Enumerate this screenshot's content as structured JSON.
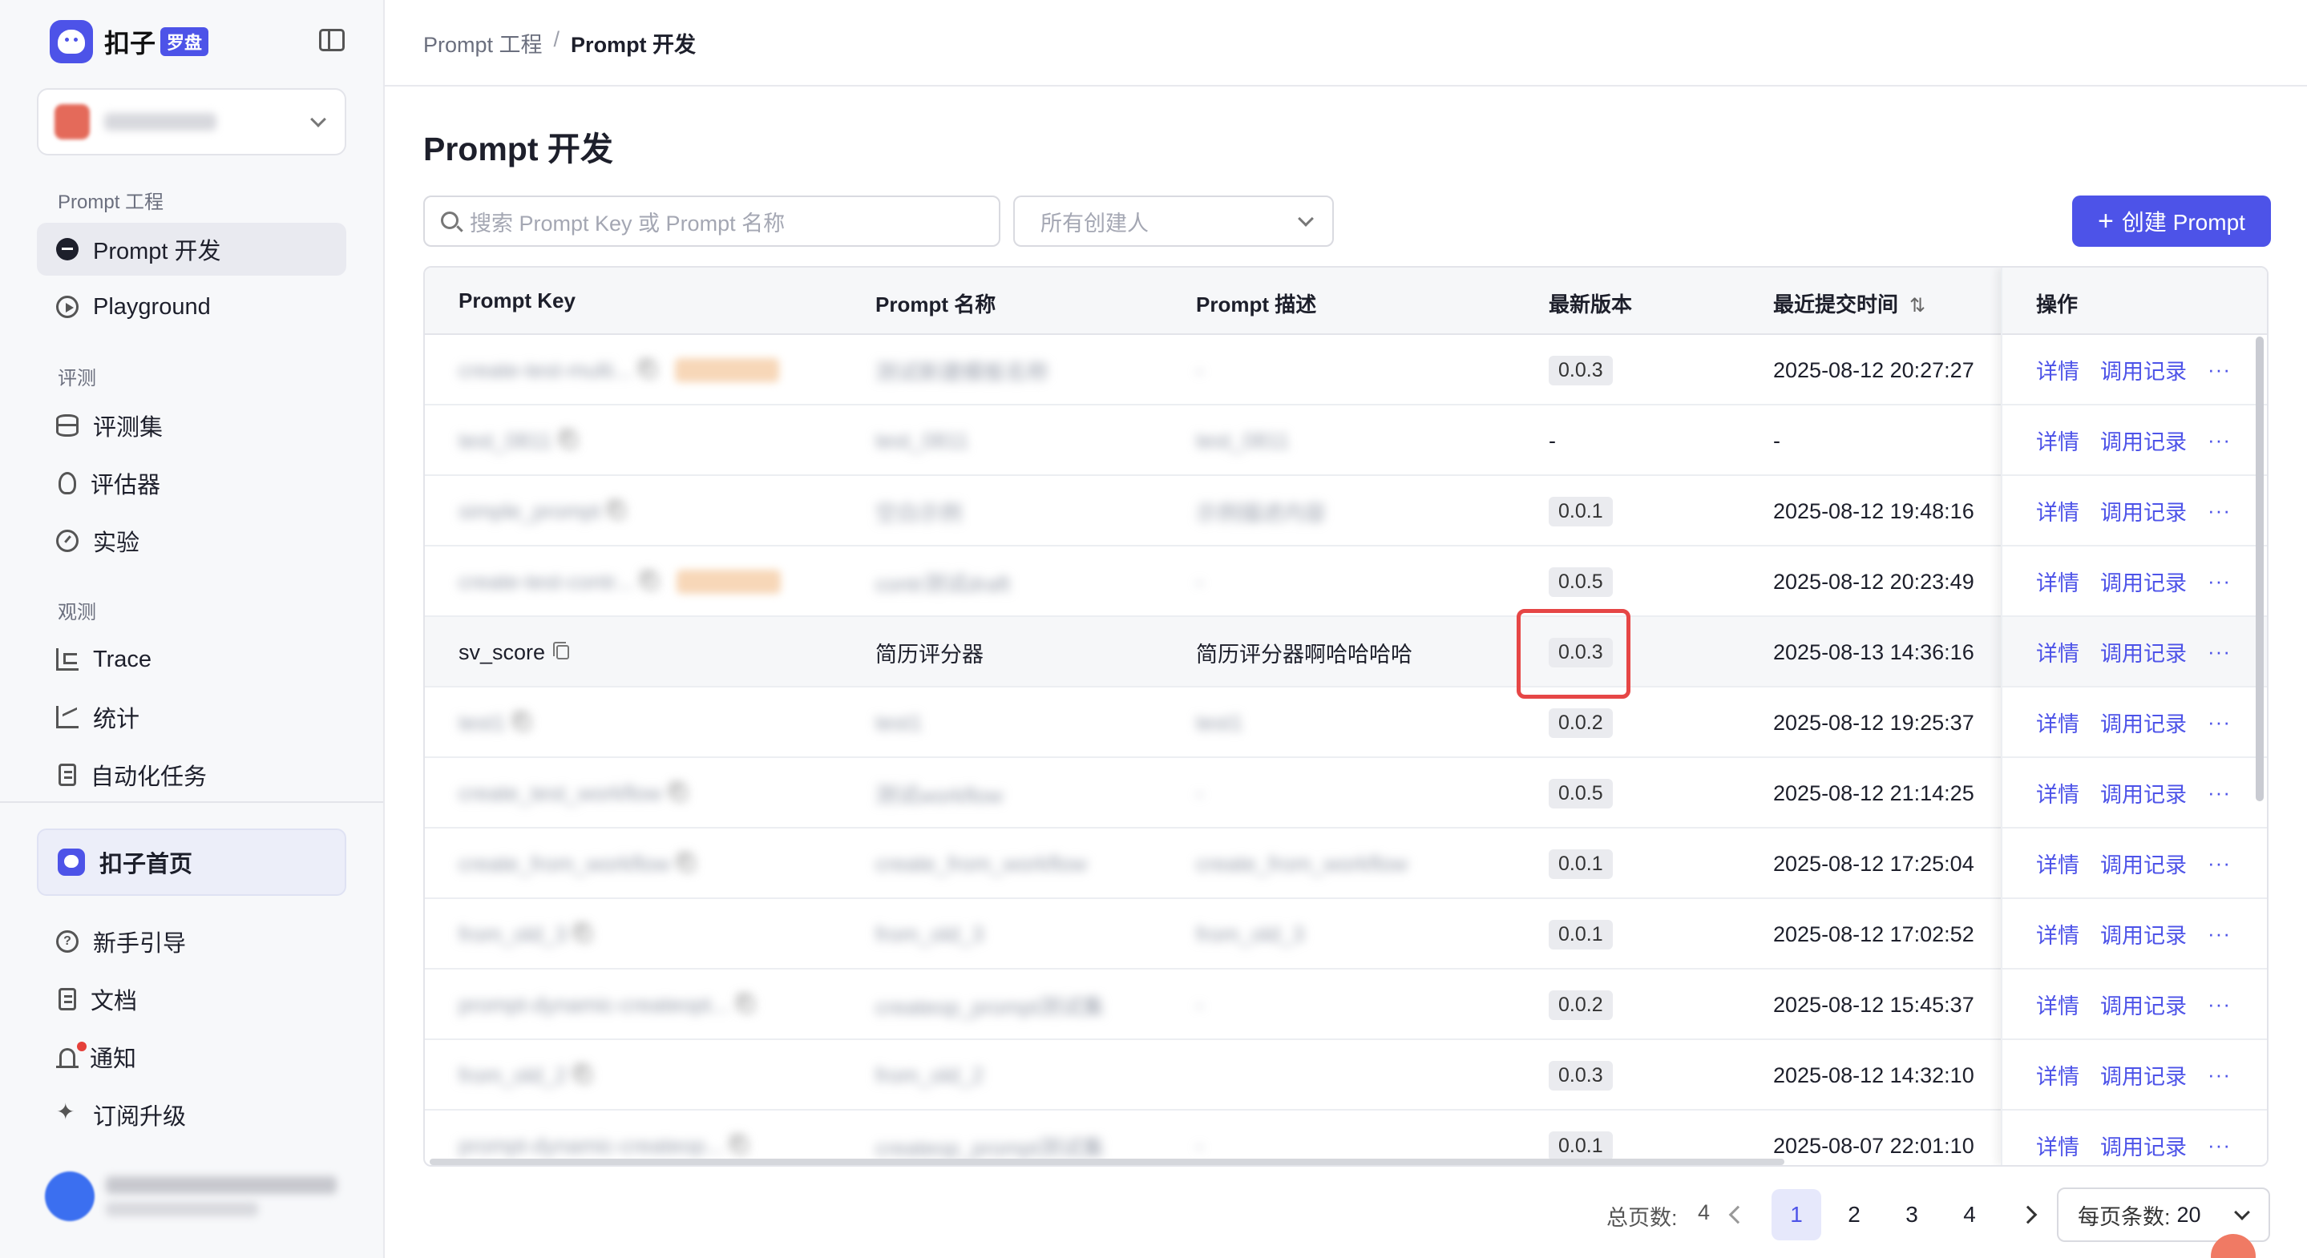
{
  "brand": {
    "name": "扣子",
    "tag": "罗盘"
  },
  "sidebar": {
    "groups": [
      {
        "title": "Prompt 工程",
        "items": [
          {
            "label": "Prompt 开发",
            "icon": "chat-icon",
            "active": true
          },
          {
            "label": "Playground",
            "icon": "play-icon"
          }
        ]
      },
      {
        "title": "评测",
        "items": [
          {
            "label": "评测集",
            "icon": "database-icon"
          },
          {
            "label": "评估器",
            "icon": "bulb-icon"
          },
          {
            "label": "实验",
            "icon": "gauge-icon"
          }
        ]
      },
      {
        "title": "观测",
        "items": [
          {
            "label": "Trace",
            "icon": "trace-icon"
          },
          {
            "label": "统计",
            "icon": "chart-icon"
          },
          {
            "label": "自动化任务",
            "icon": "task-icon"
          }
        ]
      }
    ],
    "home": "扣子首页",
    "footer_items": [
      {
        "label": "新手引导",
        "icon": "question-icon"
      },
      {
        "label": "文档",
        "icon": "doc-icon"
      },
      {
        "label": "通知",
        "icon": "bell-icon"
      },
      {
        "label": "订阅升级",
        "icon": "sparkle-icon"
      }
    ]
  },
  "breadcrumb": {
    "parent": "Prompt 工程",
    "separator": "/",
    "current": "Prompt 开发"
  },
  "page": {
    "title": "Prompt 开发"
  },
  "filters": {
    "search_placeholder": "搜索 Prompt Key 或 Prompt 名称",
    "creator_placeholder": "所有创建人",
    "create_button": "创建 Prompt"
  },
  "table": {
    "columns": [
      "Prompt Key",
      "Prompt 名称",
      "Prompt 描述",
      "最新版本",
      "最近提交时间",
      "操作"
    ],
    "rows": [
      {
        "key": "",
        "name": "",
        "desc": "",
        "version": "0.0.3",
        "time": "2025-08-12 20:27:27",
        "blurred": true,
        "tag": true
      },
      {
        "key": "",
        "name": "",
        "desc": "",
        "version": "-",
        "time": "-",
        "blurred": true,
        "tag": false
      },
      {
        "key": "",
        "name": "",
        "desc": "",
        "version": "0.0.1",
        "time": "2025-08-12 19:48:16",
        "blurred": true,
        "tag": false
      },
      {
        "key": "",
        "name": "",
        "desc": "",
        "version": "0.0.5",
        "time": "2025-08-12 20:23:49",
        "blurred": true,
        "tag": true
      },
      {
        "key": "sv_score",
        "name": "简历评分器",
        "desc": "简历评分器啊哈哈哈哈",
        "version": "0.0.3",
        "time": "2025-08-13 14:36:16",
        "blurred": false,
        "tag": false
      },
      {
        "key": "",
        "name": "",
        "desc": "",
        "version": "0.0.2",
        "time": "2025-08-12 19:25:37",
        "blurred": true,
        "tag": false
      },
      {
        "key": "",
        "name": "",
        "desc": "",
        "version": "0.0.5",
        "time": "2025-08-12 21:14:25",
        "blurred": true,
        "tag": false
      },
      {
        "key": "",
        "name": "",
        "desc": "",
        "version": "0.0.1",
        "time": "2025-08-12 17:25:04",
        "blurred": true,
        "tag": false
      },
      {
        "key": "",
        "name": "",
        "desc": "",
        "version": "0.0.1",
        "time": "2025-08-12 17:02:52",
        "blurred": true,
        "tag": false
      },
      {
        "key": "",
        "name": "",
        "desc": "",
        "version": "0.0.2",
        "time": "2025-08-12 15:45:37",
        "blurred": true,
        "tag": false
      },
      {
        "key": "",
        "name": "",
        "desc": "",
        "version": "0.0.3",
        "time": "2025-08-12 14:32:10",
        "blurred": true,
        "tag": false
      },
      {
        "key": "",
        "name": "",
        "desc": "",
        "version": "0.0.1",
        "time": "2025-08-07 22:01:10",
        "blurred": true,
        "tag": false
      }
    ],
    "actions": {
      "detail": "详情",
      "records": "调用记录",
      "more": "···"
    }
  },
  "pagination": {
    "total_label": "总页数:",
    "total_pages": "4",
    "pages": [
      "1",
      "2",
      "3",
      "4"
    ],
    "current": "1",
    "page_size_label": "每页条数:",
    "page_size": "20"
  },
  "colors": {
    "accent": "#4d53e8",
    "highlight_border": "#e64646"
  }
}
